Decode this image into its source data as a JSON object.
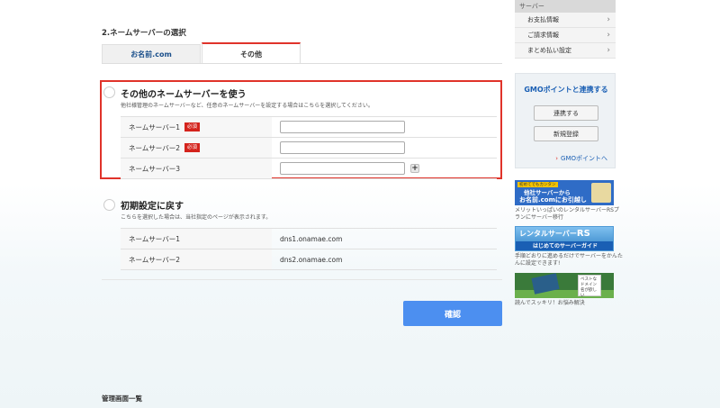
{
  "section": {
    "title": "2.ネームサーバーの選択"
  },
  "tabs": [
    {
      "label": "お名前.com",
      "active": false
    },
    {
      "label": "その他",
      "active": true
    }
  ],
  "option_other": {
    "title": "その他のネームサーバーを使う",
    "description": "他社様管理のネームサーバーなど、任意のネームサーバーを設定する場合はこちらを選択してください。",
    "required_label": "必須",
    "rows": [
      {
        "label": "ネームサーバー1",
        "required": true,
        "value": ""
      },
      {
        "label": "ネームサーバー2",
        "required": true,
        "value": ""
      },
      {
        "label": "ネームサーバー3",
        "required": false,
        "value": ""
      }
    ],
    "add_button": "+"
  },
  "option_default": {
    "title": "初期設定に戻す",
    "description": "こちらを選択した場合は、当社指定のページが表示されます。",
    "rows": [
      {
        "label": "ネームサーバー1",
        "value": "dns1.onamae.com"
      },
      {
        "label": "ネームサーバー2",
        "value": "dns2.onamae.com"
      }
    ]
  },
  "confirm_button": "確認",
  "footer": {
    "title": "管理画面一覧"
  },
  "sidebar": {
    "heading": "サーバー",
    "items": [
      {
        "label": "お支払情報"
      },
      {
        "label": "ご請求情報"
      },
      {
        "label": "まとめ払い設定"
      }
    ],
    "gmo": {
      "title": "GMOポイントと連携する",
      "link_button": "連携する",
      "register_button": "新規登録",
      "link": "GMOポイントへ"
    },
    "banners": [
      {
        "tag": "初めてでもカンタン",
        "line1": "他社サーバーから",
        "line2": "お名前.comにお引越し",
        "caption": "メリットいっぱいのレンタルサーバーRSプランにサーバー移行"
      },
      {
        "line1": "レンタルサーバー",
        "line1_suffix": "RS",
        "line2": "はじめてのサーバーガイド",
        "caption": "手順どおりに進めるだけでサーバーをかんたんに設定できます!"
      },
      {
        "card": "ベストなドメイン名が欲しい",
        "caption": "読んでスッキリ！お悩み解決"
      }
    ]
  }
}
